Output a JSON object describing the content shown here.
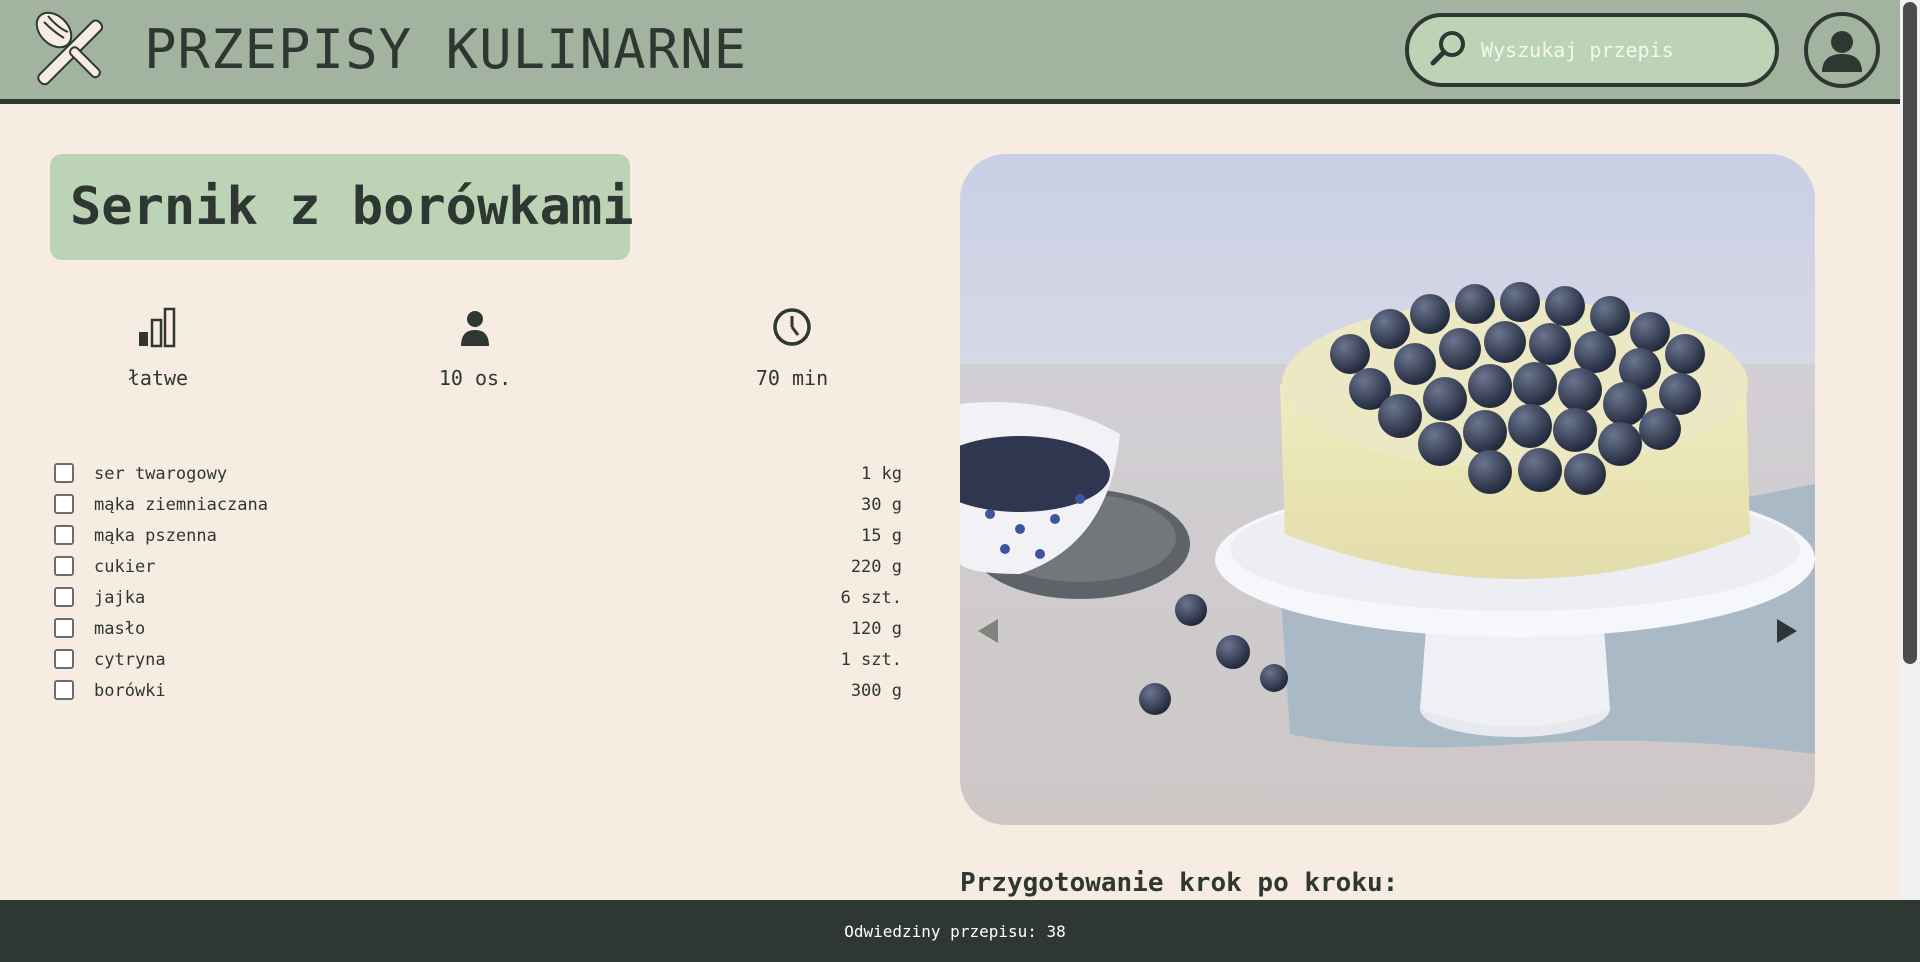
{
  "header": {
    "site_title": "PRZEPISY KULINARNE",
    "search_placeholder": "Wyszukaj przepis",
    "logo_icon": "whisk-rolling-pin-icon",
    "search_icon": "search-icon",
    "avatar_icon": "user-icon"
  },
  "recipe": {
    "title": "Sernik z borówkami",
    "stats": [
      {
        "icon": "difficulty-bars-icon",
        "value": "łatwe"
      },
      {
        "icon": "person-icon",
        "value": "10 os."
      },
      {
        "icon": "clock-icon",
        "value": "70 min"
      }
    ],
    "ingredients": [
      {
        "name": "ser twarogowy",
        "qty": "1 kg",
        "checked": false
      },
      {
        "name": "mąka ziemniaczana",
        "qty": "30 g",
        "checked": false
      },
      {
        "name": "mąka pszenna",
        "qty": "15 g",
        "checked": false
      },
      {
        "name": "cukier",
        "qty": "220 g",
        "checked": false
      },
      {
        "name": "jajka",
        "qty": "6 szt.",
        "checked": false
      },
      {
        "name": "masło",
        "qty": "120 g",
        "checked": false
      },
      {
        "name": "cytryna",
        "qty": "1 szt.",
        "checked": false
      },
      {
        "name": "borówki",
        "qty": "300 g",
        "checked": false
      }
    ],
    "gallery": {
      "prev_icon": "arrow-left-icon",
      "next_icon": "arrow-right-icon"
    },
    "steps_heading": "Przygotowanie krok po kroku:"
  },
  "footer": {
    "visits_text": "Odwiedziny przepisu: 38"
  },
  "colors": {
    "header_bg": "#a2b39f",
    "accent_green": "#bdd3b6",
    "dark": "#2f3732",
    "page_bg": "#f7ece2"
  }
}
